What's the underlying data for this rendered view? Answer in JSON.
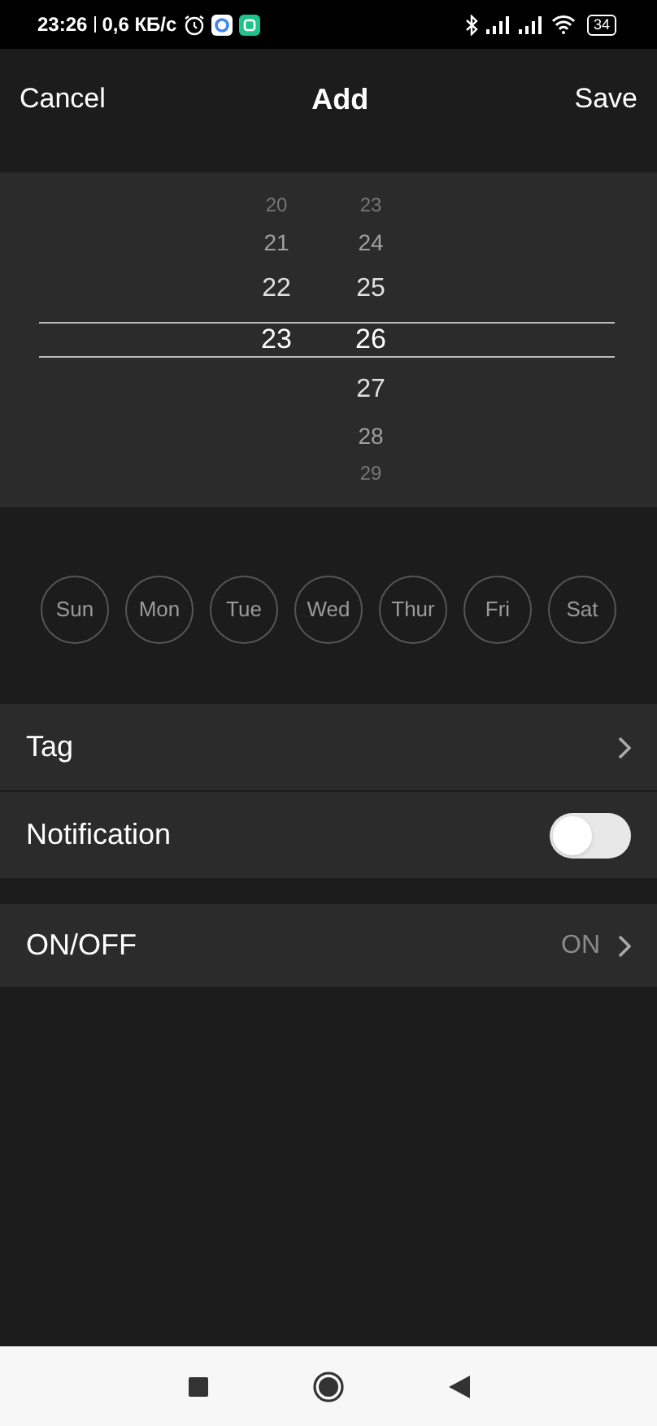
{
  "status_bar": {
    "time": "23:26",
    "speed": "0,6 КБ/с",
    "battery": "34"
  },
  "header": {
    "cancel": "Cancel",
    "title": "Add",
    "save": "Save"
  },
  "time_picker": {
    "hours": [
      {
        "text": "20",
        "selected": false
      },
      {
        "text": "21",
        "selected": false
      },
      {
        "text": "22",
        "selected": false
      },
      {
        "text": "23",
        "selected": true
      }
    ],
    "minutes": [
      {
        "text": "23",
        "selected": false
      },
      {
        "text": "24",
        "selected": false
      },
      {
        "text": "25",
        "selected": false
      },
      {
        "text": "26",
        "selected": true
      },
      {
        "text": "27",
        "selected": false
      },
      {
        "text": "28",
        "selected": false
      },
      {
        "text": "29",
        "selected": false
      }
    ]
  },
  "days": [
    {
      "label": "Sun",
      "selected": false
    },
    {
      "label": "Mon",
      "selected": false
    },
    {
      "label": "Tue",
      "selected": false
    },
    {
      "label": "Wed",
      "selected": false
    },
    {
      "label": "Thur",
      "selected": false
    },
    {
      "label": "Fri",
      "selected": false
    },
    {
      "label": "Sat",
      "selected": false
    }
  ],
  "settings": [
    {
      "kind": "link",
      "label": "Tag"
    },
    {
      "kind": "toggle",
      "label": "Notification",
      "on": false
    }
  ],
  "power": {
    "label": "ON/OFF",
    "value": "ON"
  }
}
